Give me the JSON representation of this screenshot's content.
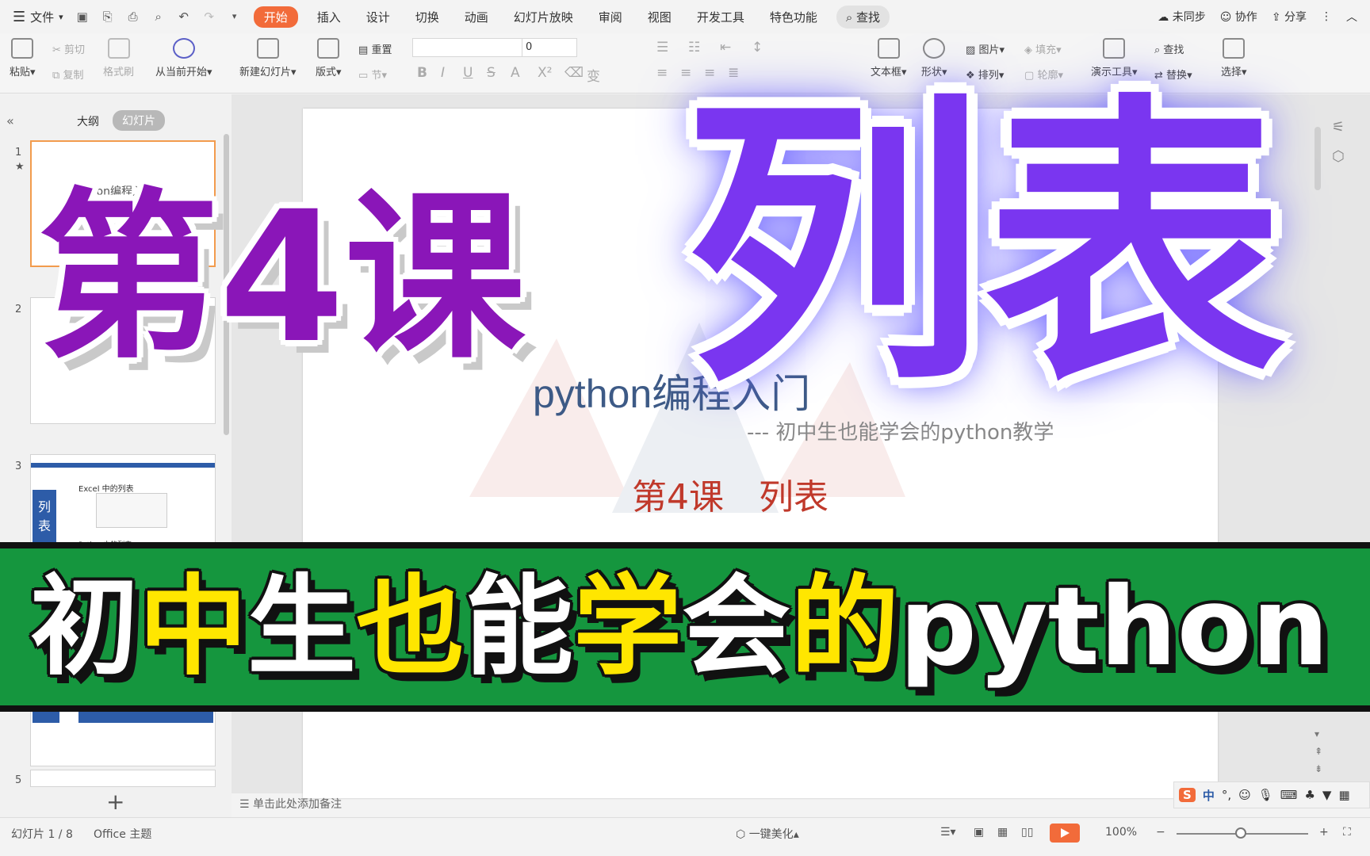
{
  "menubar": {
    "file": "文件",
    "tabs": [
      "开始",
      "插入",
      "设计",
      "切换",
      "动画",
      "幻灯片放映",
      "审阅",
      "视图",
      "开发工具",
      "特色功能"
    ],
    "active_tab": "开始",
    "search": "查找",
    "right": [
      "未同步",
      "协作",
      "分享"
    ]
  },
  "ribbon": {
    "paste": "粘贴",
    "cut": "剪切",
    "copy": "复制",
    "format_painter": "格式刷",
    "from_current": "从当前开始",
    "new_slide": "新建幻灯片",
    "layout": "版式",
    "reset": "重置",
    "section": "节",
    "font_size": "0",
    "textbox": "文本框",
    "shape": "形状",
    "picture": "图片",
    "fill": "填充",
    "arrange": "排列",
    "outline": "轮廓",
    "present_tools": "演示工具",
    "find": "查找",
    "replace": "替换",
    "select": "选择"
  },
  "panel": {
    "tab_outline": "大纲",
    "tab_slides": "幻灯片",
    "slide_numbers": [
      "1",
      "2",
      "3",
      "5"
    ],
    "thumb1_title": "python编程入门",
    "thumb3_heading": "Excel 中的列表",
    "thumb3_side": "列表",
    "thumb3_python": "Python中的列表"
  },
  "slide": {
    "title": "python编程入门",
    "subtitle": "--- 初中生也能学会的python教学",
    "lesson": "第4课　列表"
  },
  "notes_placeholder": "单击此处添加备注",
  "status": {
    "slide_counter": "幻灯片 1 / 8",
    "theme": "Office 主题",
    "beautify": "一键美化",
    "zoom": "100%"
  },
  "ime": {
    "logo": "S",
    "mode": "中"
  },
  "overlay": {
    "lesson": "第4课",
    "topic": "列表",
    "banner_parts": [
      {
        "t": "初",
        "y": false
      },
      {
        "t": "中",
        "y": true
      },
      {
        "t": "生",
        "y": false
      },
      {
        "t": "也",
        "y": true
      },
      {
        "t": "能",
        "y": false
      },
      {
        "t": "学",
        "y": true
      },
      {
        "t": "会",
        "y": false
      },
      {
        "t": "的",
        "y": true
      },
      {
        "t": "python",
        "y": false
      }
    ]
  }
}
